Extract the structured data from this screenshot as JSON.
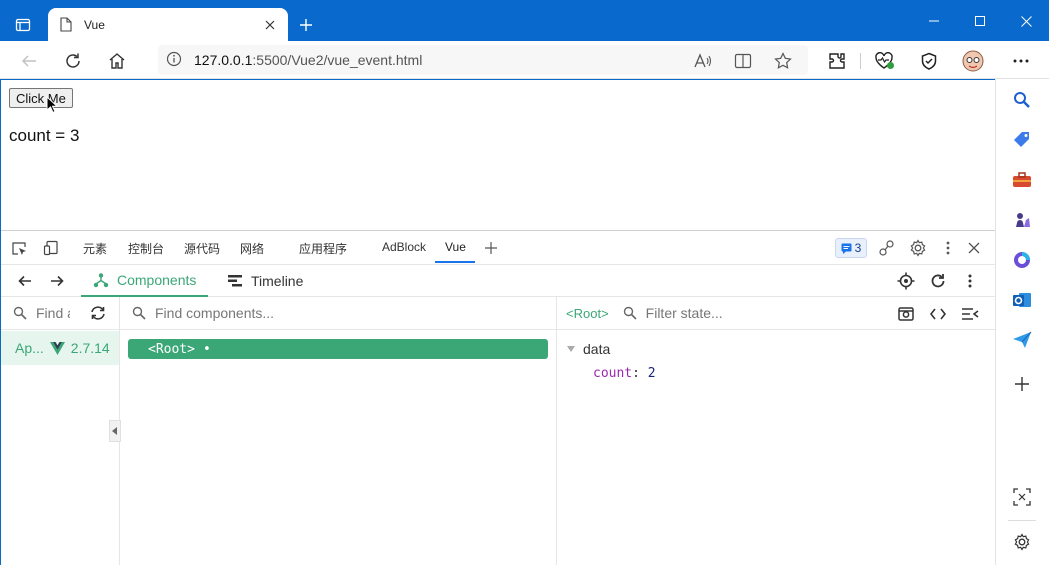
{
  "browser": {
    "tab_title": "Vue",
    "url_host": "127.0.0.1",
    "url_path": ":5500/Vue2/vue_event.html"
  },
  "page": {
    "button_label": "Click Me",
    "count_label": "count = 3"
  },
  "devtools": {
    "tabs": [
      {
        "label": "元素"
      },
      {
        "label": "控制台"
      },
      {
        "label": "源代码"
      },
      {
        "label": "网络"
      },
      {
        "label": "应用程序"
      },
      {
        "label": "AdBlock"
      },
      {
        "label": "Vue"
      }
    ],
    "issues_count": "3",
    "vue": {
      "components_tab": "Components",
      "timeline_tab": "Timeline",
      "find_app_placeholder": "Find a",
      "find_components_placeholder": "Find components...",
      "filter_state_placeholder": "Filter state...",
      "app_name": "Ap...",
      "vue_version": "2.7.14",
      "root_component": "<Root>",
      "selected_label": "<Root>",
      "state_section": "data",
      "state_key": "count",
      "state_value": "2"
    }
  },
  "colors": {
    "titlebar": "#0a69cc",
    "vue_green": "#3ba776",
    "accent_blue": "#1a73e8"
  }
}
